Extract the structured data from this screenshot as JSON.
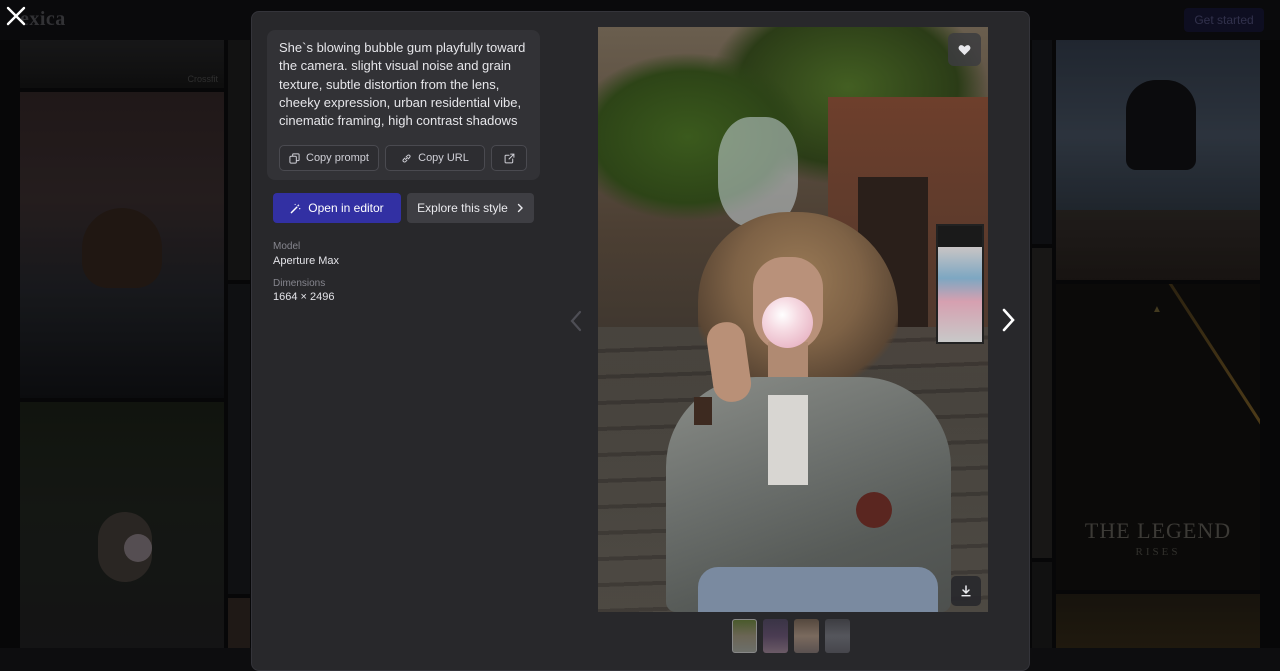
{
  "background": {
    "logo": "exica",
    "get_started": "Get started",
    "tile_watermark": "Crossfit",
    "legend_title": "THE LEGEND",
    "legend_subtitle": "RISES"
  },
  "modal": {
    "prompt": "She`s blowing bubble gum playfully toward the camera. slight visual noise and grain texture, subtle distortion from the lens, cheeky expression, urban residential vibe, cinematic framing, high contrast shadows",
    "copy_prompt_label": "Copy prompt",
    "copy_url_label": "Copy URL",
    "open_editor_label": "Open in editor",
    "explore_style_label": "Explore this style",
    "model_label": "Model",
    "model_value": "Aperture Max",
    "dimensions_label": "Dimensions",
    "dimensions_value": "1664 × 2496"
  },
  "icons": {
    "close": "close-icon",
    "copy": "copy-icon",
    "link": "link-icon",
    "external": "external-link-icon",
    "wand": "magic-wand-icon",
    "chevron_right": "chevron-right-icon",
    "heart": "heart-icon",
    "download": "download-icon"
  },
  "colors": {
    "accent": "#3230a3",
    "modal_bg": "#28282b"
  }
}
